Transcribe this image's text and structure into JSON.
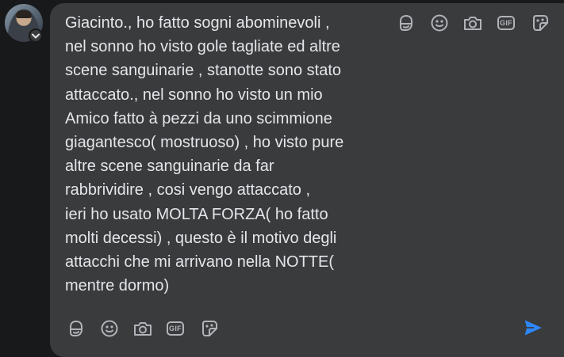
{
  "comment": {
    "lines": [
      "Giacinto., ho fatto sogni abominevoli ,",
      "nel sonno ho visto gole tagliate ed altre",
      "scene sanguinarie , stanotte sono stato",
      "attaccato., nel sonno ho visto un mio",
      "Amico fatto à pezzi da uno scimmione",
      "giagantesco( mostruoso) , ho visto pure",
      "altre scene sanguinarie da far",
      "rabbrividire , cosi vengo attaccato ,",
      "ieri ho usato MOLTA FORZA( ho fatto",
      "molti decessi) , questo è il motivo degli",
      "attacchi che mi arrivano nella NOTTE(",
      "mentre dormo)"
    ]
  },
  "toolbar_top": {
    "icons": [
      "avatar-sticker-icon",
      "emoji-icon",
      "camera-icon",
      "gif-icon",
      "sticker-icon"
    ],
    "gif_label": "GIF"
  },
  "toolbar_bottom": {
    "icons": [
      "avatar-sticker-icon",
      "emoji-icon",
      "camera-icon",
      "gif-icon",
      "sticker-icon",
      "send-icon"
    ],
    "gif_label": "GIF"
  },
  "colors": {
    "background": "#18191a",
    "bubble": "#3a3b3c",
    "text": "#e4e6eb",
    "icon": "#b0b3b8",
    "send": "#2d88ff"
  }
}
